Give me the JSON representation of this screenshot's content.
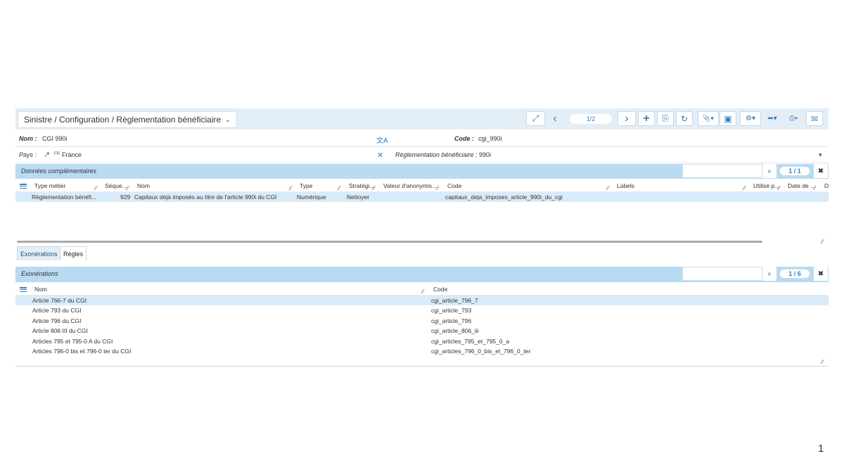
{
  "breadcrumb": "Sinistre / Configuration / Règlementation bénéficiaire",
  "breadcrumb_caret": "⌄",
  "toolbar": {
    "expand_icon": "⤢",
    "prev_icon": "‹",
    "pager": "1/2",
    "next_icon": "›",
    "add_icon": "+",
    "save_icon": "⎘",
    "refresh_icon": "↻",
    "attach_icon": "📎▾",
    "comment_icon": "▣",
    "settings_icon": "⚙▾",
    "share_icon": "➦▾",
    "print_icon": "⎙▾",
    "mail_icon": "✉"
  },
  "form": {
    "nom_label": "Nom :",
    "nom_value": "CGI 990i",
    "translate_icon": "文A",
    "code_label": "Code :",
    "code_value": "cgi_990i",
    "pays_label": "Pays :",
    "pays_link_icon": "↗",
    "pays_flag": "FR",
    "pays_value": "France",
    "clear_icon": "✕",
    "reglementation_label": "Règlementation bénéficiaire :",
    "reglementation_value": "990i",
    "dropdown_icon": "▾"
  },
  "donnees": {
    "title": "Données complémentaires",
    "count": "1 / 1",
    "search_icon": "🔍",
    "close_icon": "✖",
    "headers": [
      "Type métier",
      "Séque...",
      "Nom",
      "Type",
      "Stratégi...",
      "Valeur d'anonymis...",
      "Code",
      "Labels",
      "Utilisé p...",
      "Date de ...",
      "D"
    ],
    "rows": [
      {
        "type_metier": "Règlementation bénéfi...",
        "sequence": "929",
        "nom": "Capitaux déjà imposés au titre de l'article 990i du CGI",
        "type": "Numérique",
        "strategie": "Nettoyer",
        "code": "capitaux_deja_imposes_article_990i_du_cgi"
      }
    ]
  },
  "tabs": [
    "Exonérations",
    "Règles"
  ],
  "exonerations": {
    "title": "Exonérations",
    "count": "1 / 6",
    "search_icon": "🔍",
    "close_icon": "✖",
    "headers": [
      "Nom",
      "Code"
    ],
    "rows": [
      {
        "nom": "Article 766-7 du CGI",
        "code": "cgi_article_796_7"
      },
      {
        "nom": "Article 793 du CGI",
        "code": "cgi_article_793"
      },
      {
        "nom": "Article 796 du CGI",
        "code": "cgi_article_796"
      },
      {
        "nom": "Article 806 III du CGI",
        "code": "cgi_article_806_iii"
      },
      {
        "nom": "Articles 795 et 795-0 A du CGI",
        "code": "cgi_articles_795_et_795_0_a"
      },
      {
        "nom": "Articles 796-0 bis et 796-0 ter du CGI",
        "code": "cgi_articles_796_0_bis_et_796_0_ter"
      }
    ]
  },
  "page_number": "1"
}
